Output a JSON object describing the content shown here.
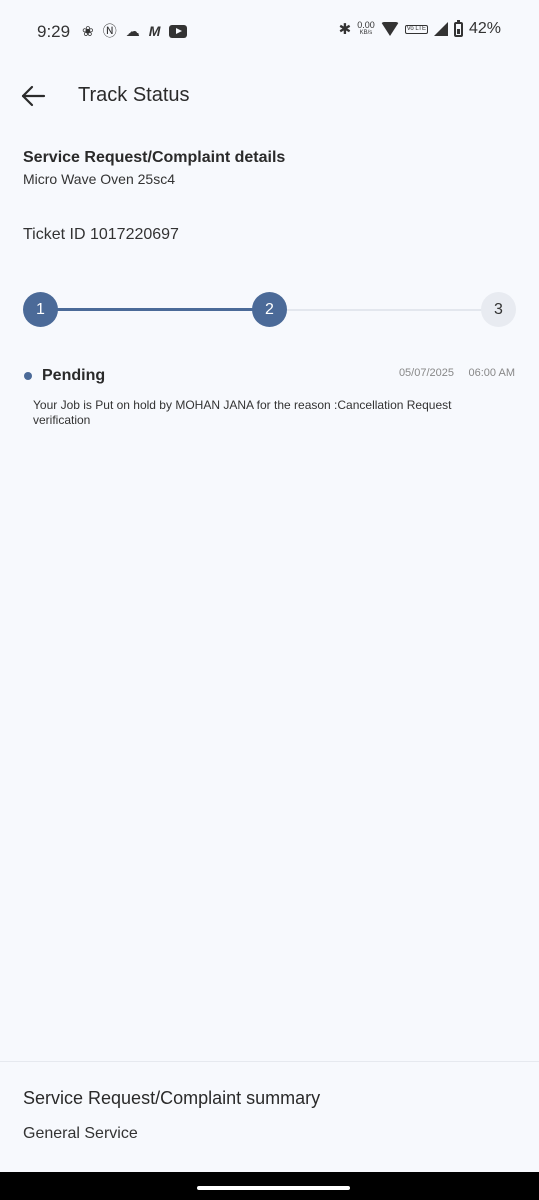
{
  "status_bar": {
    "time": "9:29",
    "speed_value": "0.00",
    "speed_unit": "KB/s",
    "network_badge": "Vo LTE",
    "battery_percent": "42%",
    "battery_level": 0.42,
    "left_icons": [
      "fan-icon",
      "app-icon",
      "cloud-icon",
      "m-icon",
      "youtube-icon"
    ]
  },
  "header": {
    "title": "Track Status"
  },
  "details": {
    "heading": "Service Request/Complaint details",
    "product": "Micro Wave Oven 25sc4",
    "ticket": "Ticket ID 1017220697"
  },
  "stepper": {
    "steps": [
      {
        "label": "1",
        "state": "done"
      },
      {
        "label": "2",
        "state": "done"
      },
      {
        "label": "3",
        "state": "todo"
      }
    ],
    "progress": 0.5,
    "active_color": "#4b6a98"
  },
  "event": {
    "status": "Pending",
    "date": "05/07/2025",
    "time": "06:00 AM",
    "message": "Your Job is Put on hold by MOHAN JANA for the reason :Cancellation Request verification"
  },
  "summary": {
    "heading": "Service Request/Complaint summary",
    "value": "General Service"
  }
}
